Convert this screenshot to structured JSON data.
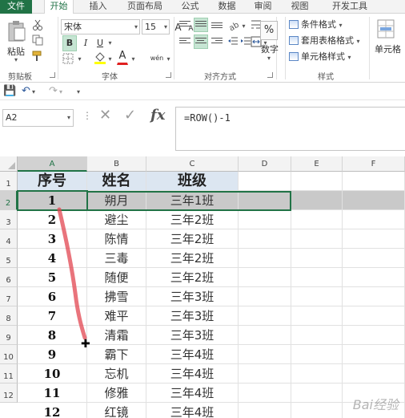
{
  "tabs": [
    "文件",
    "开始",
    "插入",
    "页面布局",
    "公式",
    "数据",
    "审阅",
    "视图",
    "开发工具"
  ],
  "ribbon": {
    "clipboard": {
      "paste": "粘贴",
      "label": "剪贴板"
    },
    "font": {
      "name": "宋体",
      "size": "15",
      "bold": "B",
      "italic": "I",
      "underline": "U",
      "grow": "A",
      "shrink": "A",
      "color_a": "A",
      "phonetic": "wén",
      "label": "字体"
    },
    "alignment": {
      "label": "对齐方式"
    },
    "number": {
      "percent": "%",
      "label": "数字"
    },
    "styles": {
      "conditional": "条件格式",
      "table": "套用表格格式",
      "cell": "单元格样式",
      "label": "样式"
    },
    "cells": {
      "label": "单元格"
    }
  },
  "formula_bar": {
    "namebox": "A2",
    "fx": "fx",
    "formula": "=ROW()-1"
  },
  "columns": [
    "A",
    "B",
    "C",
    "D",
    "E",
    "F"
  ],
  "rows": [
    "1",
    "2",
    "3",
    "4",
    "5",
    "6",
    "7",
    "8",
    "9",
    "10",
    "11",
    "12"
  ],
  "table": {
    "headers": [
      "序号",
      "姓名",
      "班级"
    ],
    "data": [
      [
        "1",
        "朔月",
        "三年1班"
      ],
      [
        "2",
        "避尘",
        "三年2班"
      ],
      [
        "3",
        "陈情",
        "三年2班"
      ],
      [
        "4",
        "三毒",
        "三年2班"
      ],
      [
        "5",
        "随便",
        "三年2班"
      ],
      [
        "6",
        "拂雪",
        "三年3班"
      ],
      [
        "7",
        "难平",
        "三年3班"
      ],
      [
        "8",
        "清霜",
        "三年3班"
      ],
      [
        "9",
        "霸下",
        "三年4班"
      ],
      [
        "10",
        "忘机",
        "三年4班"
      ],
      [
        "11",
        "修雅",
        "三年4班"
      ],
      [
        "12",
        "红镜",
        "三年4班"
      ]
    ]
  },
  "watermark": "Bai经验",
  "colors": {
    "accent": "#217346",
    "header_fill": "#dce6f1",
    "selected_row": "#c9c9c9"
  }
}
